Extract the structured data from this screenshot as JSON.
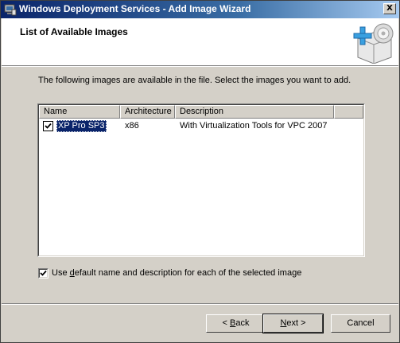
{
  "window": {
    "title": "Windows Deployment Services - Add Image Wizard",
    "close_glyph": "X",
    "title_icon": "wds-app-icon"
  },
  "header": {
    "title": "List of Available Images",
    "icon": "add-image-icon"
  },
  "instruction": "The following images are available in the file. Select the images you want to add.",
  "list": {
    "columns": [
      "Name",
      "Architecture",
      "Description"
    ],
    "rows": [
      {
        "checked": true,
        "name": "XP Pro SP3",
        "architecture": "x86",
        "description": "With Virtualization Tools for VPC 2007"
      }
    ]
  },
  "use_default": {
    "checked": true,
    "label_pre": "Use ",
    "label_accel": "d",
    "label_post": "efault name and description for each of the selected image"
  },
  "buttons": {
    "back_pre": "< ",
    "back_accel": "B",
    "back_post": "ack",
    "next_accel": "N",
    "next_post": "ext >",
    "cancel": "Cancel"
  },
  "colors": {
    "titlebar_start": "#0a246a",
    "face": "#d4d0c8",
    "selection": "#0a246a"
  }
}
